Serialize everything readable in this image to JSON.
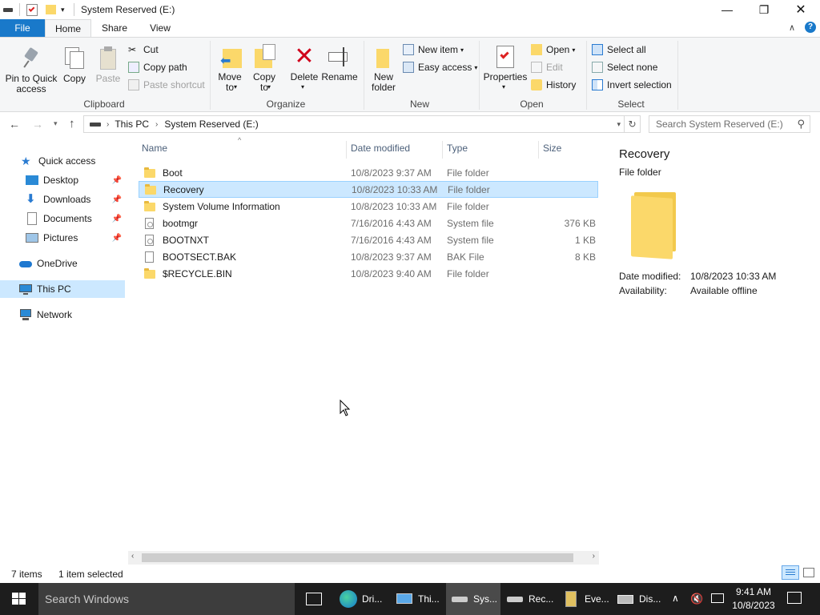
{
  "window": {
    "title": "System Reserved (E:)"
  },
  "ribbon_tabs": [
    "File",
    "Home",
    "Share",
    "View"
  ],
  "ribbon": {
    "clipboard": {
      "label": "Clipboard",
      "pin": "Pin to Quick\naccess",
      "copy": "Copy",
      "paste": "Paste",
      "cut": "Cut",
      "copy_path": "Copy path",
      "paste_shortcut": "Paste shortcut"
    },
    "organize": {
      "label": "Organize",
      "move_to": "Move\nto",
      "copy_to": "Copy\nto",
      "delete": "Delete",
      "rename": "Rename"
    },
    "new": {
      "label": "New",
      "new_folder": "New\nfolder",
      "new_item": "New item",
      "easy_access": "Easy access"
    },
    "open": {
      "label": "Open",
      "properties": "Properties",
      "open": "Open",
      "edit": "Edit",
      "history": "History"
    },
    "select": {
      "label": "Select",
      "select_all": "Select all",
      "select_none": "Select none",
      "invert": "Invert selection"
    }
  },
  "address": {
    "crumbs": [
      "This PC",
      "System Reserved (E:)"
    ],
    "search_placeholder": "Search System Reserved (E:)"
  },
  "nav": {
    "quick_access": "Quick access",
    "pinned": [
      "Desktop",
      "Downloads",
      "Documents",
      "Pictures"
    ],
    "onedrive": "OneDrive",
    "this_pc": "This PC",
    "network": "Network"
  },
  "columns": [
    "Name",
    "Date modified",
    "Type",
    "Size"
  ],
  "files": [
    {
      "name": "Boot",
      "date": "10/8/2023 9:37 AM",
      "type": "File folder",
      "size": "",
      "icon": "folder"
    },
    {
      "name": "Recovery",
      "date": "10/8/2023 10:33 AM",
      "type": "File folder",
      "size": "",
      "icon": "folder"
    },
    {
      "name": "System Volume Information",
      "date": "10/8/2023 10:33 AM",
      "type": "File folder",
      "size": "",
      "icon": "folder"
    },
    {
      "name": "bootmgr",
      "date": "7/16/2016 4:43 AM",
      "type": "System file",
      "size": "376 KB",
      "icon": "system-file"
    },
    {
      "name": "BOOTNXT",
      "date": "7/16/2016 4:43 AM",
      "type": "System file",
      "size": "1 KB",
      "icon": "system-file"
    },
    {
      "name": "BOOTSECT.BAK",
      "date": "10/8/2023 9:37 AM",
      "type": "BAK File",
      "size": "8 KB",
      "icon": "file"
    },
    {
      "name": "$RECYCLE.BIN",
      "date": "10/8/2023 9:40 AM",
      "type": "File folder",
      "size": "",
      "icon": "folder"
    }
  ],
  "preview": {
    "name": "Recovery",
    "kind": "File folder",
    "date_label": "Date modified:",
    "date_value": "10/8/2023 10:33 AM",
    "avail_label": "Availability:",
    "avail_value": "Available offline"
  },
  "status": {
    "count": "7 items",
    "selected": "1 item selected"
  },
  "taskbar": {
    "search": "Search Windows",
    "apps": [
      "Dri...",
      "Thi...",
      "Sys...",
      "Rec...",
      "Eve...",
      "Dis..."
    ],
    "time": "9:41 AM",
    "date": "10/8/2023"
  },
  "colors": {
    "accent": "#1979ca",
    "selection": "#cce8ff",
    "taskbar": "#1d1d1d",
    "folder": "#fbd86a"
  }
}
